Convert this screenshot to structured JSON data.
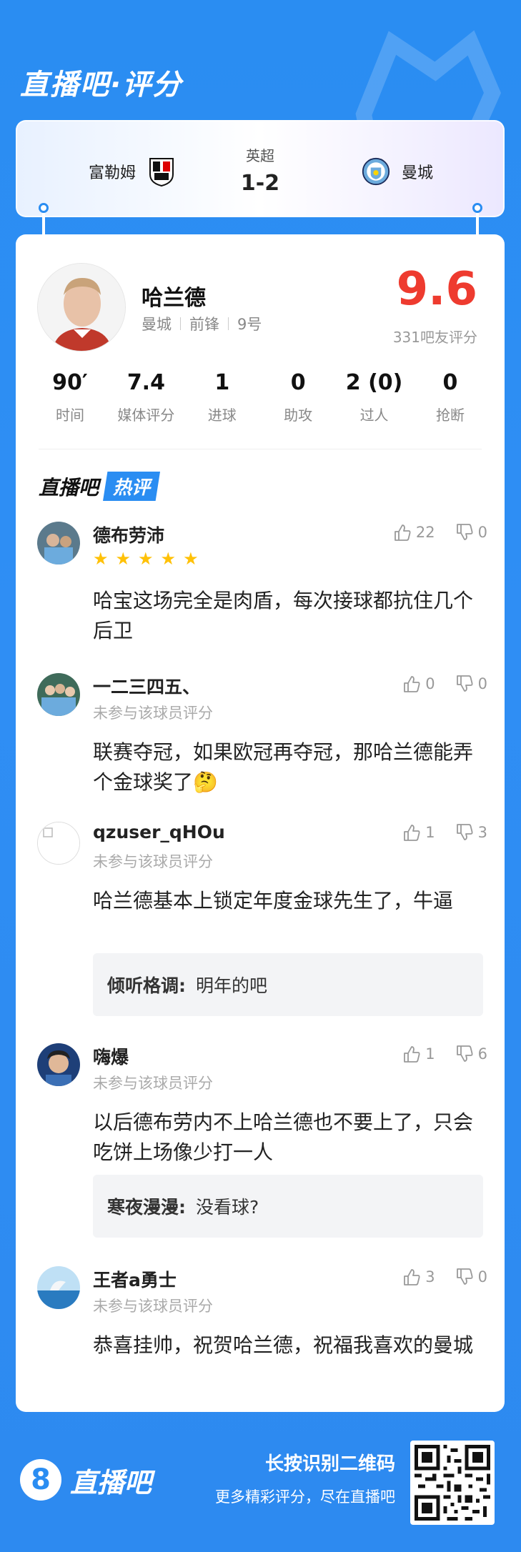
{
  "brand": {
    "title": "直播吧·评分"
  },
  "match": {
    "home_team": "富勒姆",
    "away_team": "曼城",
    "league": "英超",
    "score": "1-2"
  },
  "player": {
    "name": "哈兰德",
    "club": "曼城",
    "position": "前锋",
    "number": "9号",
    "rating": "9.6",
    "rating_count": "331吧友评分"
  },
  "stats": [
    {
      "value": "90′",
      "label": "时间"
    },
    {
      "value": "7.4",
      "label": "媒体评分"
    },
    {
      "value": "1",
      "label": "进球"
    },
    {
      "value": "0",
      "label": "助攻"
    },
    {
      "value": "2 (0)",
      "label": "过人"
    },
    {
      "value": "0",
      "label": "抢断"
    }
  ],
  "hot_comments": {
    "title_a": "直播吧",
    "title_b": "热评",
    "items": [
      {
        "user": "德布劳沛",
        "stars": 5,
        "likes": "22",
        "dislikes": "0",
        "text": "哈宝这场完全是肉盾，每次接球都抗住几个后卫"
      },
      {
        "user": "一二三四五、",
        "sub": "未参与该球员评分",
        "likes": "0",
        "dislikes": "0",
        "text": "联赛夺冠，如果欧冠再夺冠，那哈兰德能弄个金球奖了🤔"
      },
      {
        "user": "qzuser_qHOu",
        "sub": "未参与该球员评分",
        "likes": "1",
        "dislikes": "3",
        "text": "哈兰德基本上锁定年度金球先生了，牛逼",
        "reply_user": "倾听格调:",
        "reply_text": "明年的吧"
      },
      {
        "user": "嗨爆",
        "sub": "未参与该球员评分",
        "likes": "1",
        "dislikes": "6",
        "text": "以后德布劳内不上哈兰德也不要上了，只会吃饼上场像少打一人",
        "reply_user": "寒夜漫漫:",
        "reply_text": "没看球?"
      },
      {
        "user": "王者a勇士",
        "sub": "未参与该球员评分",
        "likes": "3",
        "dislikes": "0",
        "text": "恭喜挂帅，祝贺哈兰德，祝福我喜欢的曼城"
      }
    ]
  },
  "footer": {
    "logo_glyph": "8",
    "logo_text": "直播吧",
    "line1": "长按识别二维码",
    "line2": "更多精彩评分，尽在直播吧"
  },
  "colors": {
    "brand_blue": "#2a8df2",
    "rating_red": "#ee3b2f",
    "star_yellow": "#ffc107"
  }
}
